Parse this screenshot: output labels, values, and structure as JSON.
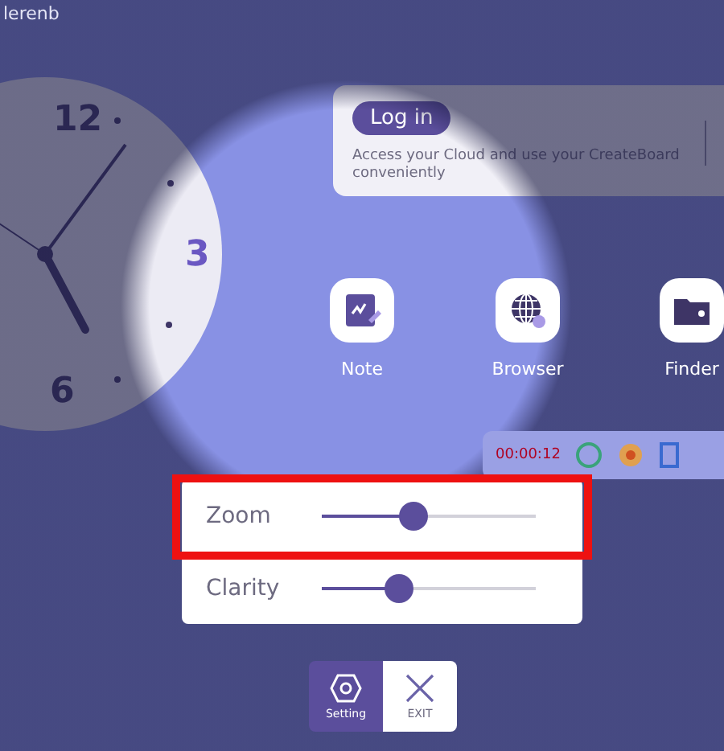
{
  "corner_label": "lerenb",
  "clock": {
    "numerals": [
      "12",
      "3",
      "6"
    ]
  },
  "login_card": {
    "button": "Log in",
    "description": "Access your Cloud and use your CreateBoard conveniently"
  },
  "apps": [
    {
      "kind": "note",
      "label": "Note"
    },
    {
      "kind": "browser",
      "label": "Browser"
    },
    {
      "kind": "finder",
      "label": "Finder"
    }
  ],
  "recorder": {
    "time": "00:00:12"
  },
  "spotlight_settings": [
    {
      "label": "Zoom",
      "level": 0.43,
      "highlighted": true
    },
    {
      "label": "Clarity",
      "level": 0.36,
      "highlighted": false
    }
  ],
  "toolbar": [
    {
      "kind": "setting",
      "label": "Setting",
      "selected": true
    },
    {
      "kind": "exit",
      "label": "EXIT",
      "selected": false
    }
  ]
}
